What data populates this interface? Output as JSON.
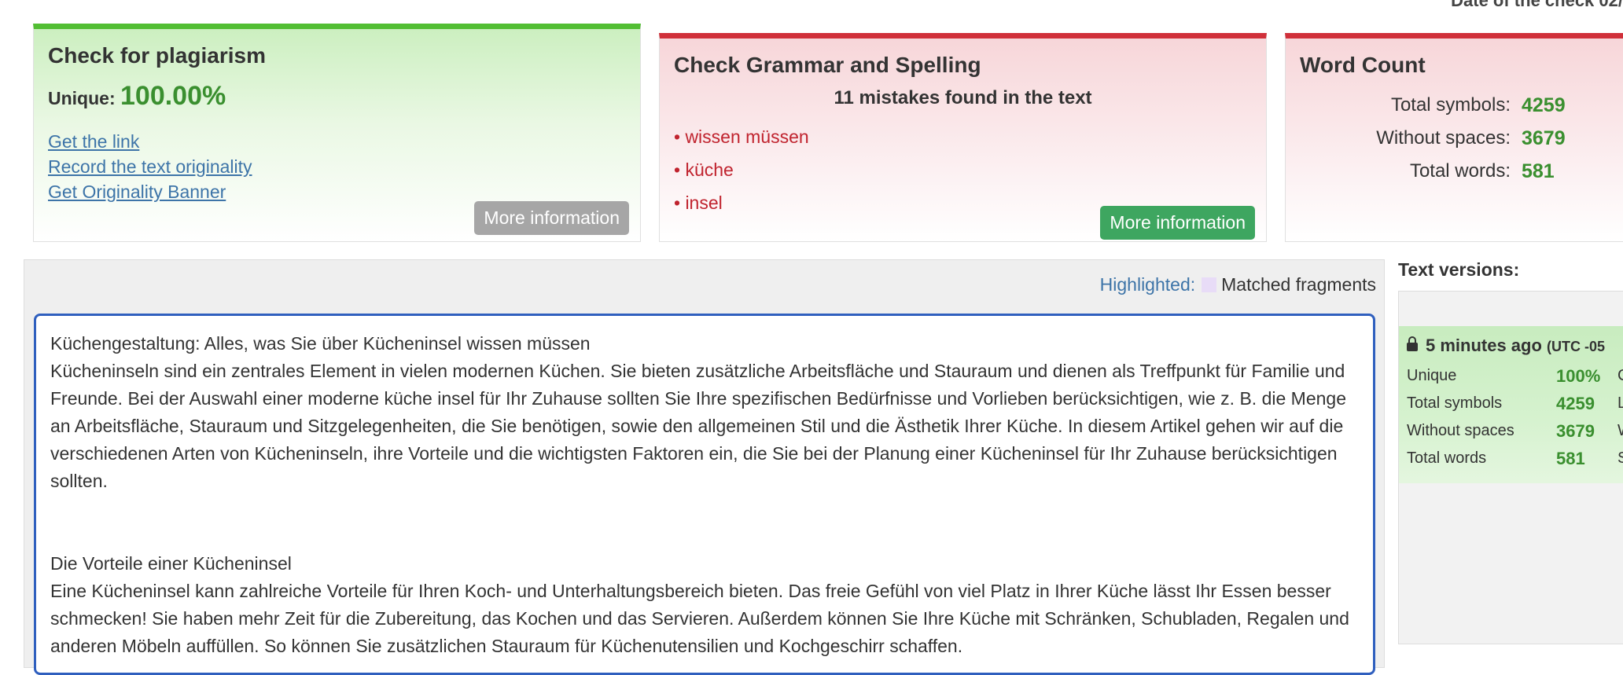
{
  "header": {
    "date_label": "Date of the check 02/"
  },
  "plagiarism": {
    "title": "Check for plagiarism",
    "unique_label": "Unique:",
    "unique_value": "100.00%",
    "links": [
      "Get the link",
      "Record the text originality",
      "Get Originality Banner"
    ],
    "more_button": "More information"
  },
  "grammar": {
    "title": "Check Grammar and Spelling",
    "summary": "11 mistakes found in the text",
    "mistakes": [
      "• wissen müssen",
      "• küche",
      "• insel"
    ],
    "more_button": "More information"
  },
  "word_count": {
    "title": "Word Count",
    "rows": [
      {
        "label": "Total symbols:",
        "value": "4259"
      },
      {
        "label": "Without spaces:",
        "value": "3679"
      },
      {
        "label": "Total words:",
        "value": "581"
      }
    ]
  },
  "text_panel": {
    "highlighted_label": "Highlighted:",
    "matched_label": "Matched fragments",
    "paragraphs": [
      "Küchengestaltung: Alles, was Sie über Kücheninsel wissen müssen",
      "Kücheninseln sind ein zentrales Element in vielen modernen Küchen. Sie bieten zusätzliche Arbeitsfläche und Stauraum und dienen als Treffpunkt für Familie und Freunde. Bei der Auswahl einer moderne küche insel für Ihr Zuhause sollten Sie Ihre spezifischen Bedürfnisse und Vorlieben berücksichtigen, wie z. B. die Menge an Arbeitsfläche, Stauraum und Sitzgelegenheiten, die Sie benötigen, sowie den allgemeinen Stil und die Ästhetik Ihrer Küche. In diesem Artikel gehen wir auf die verschiedenen Arten von Kücheninseln, ihre Vorteile und die wichtigsten Faktoren ein, die Sie bei der Planung einer Kücheninsel für Ihr Zuhause berücksichtigen sollten.",
      "Die Vorteile einer Kücheninsel",
      "Eine Kücheninsel kann zahlreiche Vorteile für Ihren Koch- und Unterhaltungsbereich bieten. Das freie Gefühl von viel Platz in Ihrer Küche lässt Ihr Essen besser schmecken! Sie haben mehr Zeit für die Zubereitung, das Kochen und das Servieren. Außerdem können Sie Ihre Küche mit Schränken, Schubladen, Regalen und anderen Möbeln auffüllen. So können Sie zusätzlichen Stauraum für Küchenutensilien und Kochgeschirr schaffen."
    ]
  },
  "versions": {
    "title": "Text versions:",
    "entry": {
      "time": "5 minutes ago",
      "timezone": "(UTC -05",
      "rows": [
        {
          "label": "Unique",
          "value": "100%",
          "extra": "C"
        },
        {
          "label": "Total symbols",
          "value": "4259",
          "extra": "L"
        },
        {
          "label": "Without spaces",
          "value": "3679",
          "extra": "W"
        },
        {
          "label": "Total words",
          "value": "581",
          "extra": "S"
        }
      ]
    }
  }
}
